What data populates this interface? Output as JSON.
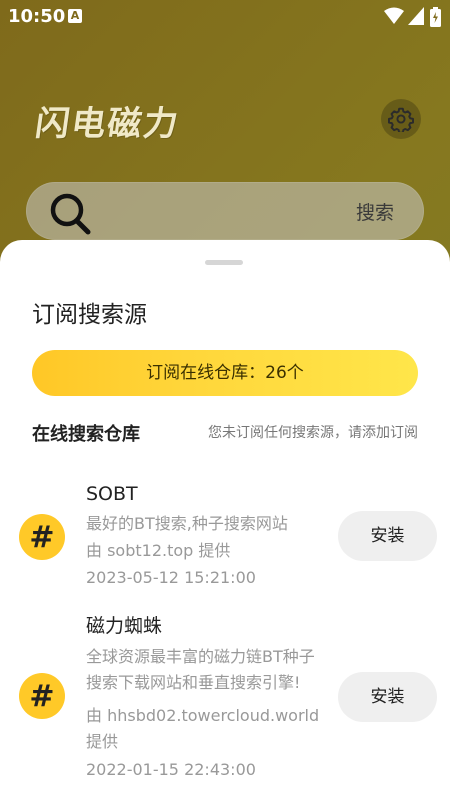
{
  "status_bar": {
    "time": "10:50",
    "notification_icon": "A"
  },
  "header": {
    "app_title": "闪电磁力",
    "settings_icon": "gear-icon"
  },
  "search": {
    "label": "搜索",
    "icon": "search-icon"
  },
  "sheet": {
    "title": "订阅搜索源",
    "subscribe_button": "订阅在线仓库：26个",
    "section_title": "在线搜索仓库",
    "section_hint": "您未订阅任何搜索源，请添加订阅",
    "sources": [
      {
        "icon": "hash-icon",
        "name": "SOBT",
        "description": "最好的BT搜索,种子搜索网站",
        "provider": "由 sobt12.top 提供",
        "date": "2023-05-12 15:21:00",
        "action": "安装"
      },
      {
        "icon": "hash-icon",
        "name": "磁力蜘蛛",
        "description_line1": "全球资源最丰富的磁力链BT种子",
        "description_line2": "搜索下载网站和垂直搜索引擎!",
        "provider_line1": "由 hhsbd02.towercloud.world",
        "provider_line2": "提供",
        "date": "2022-01-15 22:43:00",
        "action": "安装"
      }
    ]
  },
  "colors": {
    "accent": "#ffc928",
    "header_bg": "#7f6a1b"
  }
}
